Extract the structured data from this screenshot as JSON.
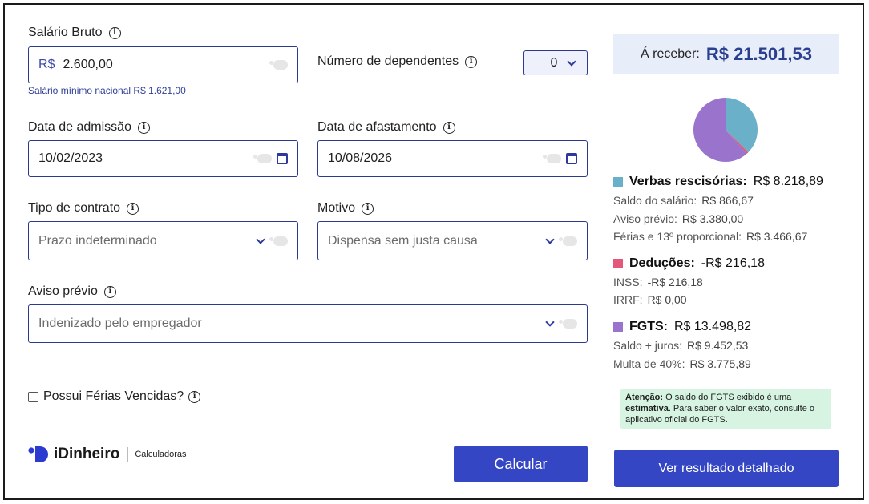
{
  "form": {
    "salario": {
      "label": "Salário Bruto",
      "prefix": "R$",
      "value": "2.600,00",
      "hint": "Salário mínimo nacional R$ 1.621,00"
    },
    "dependentes": {
      "label": "Número de dependentes",
      "value": "0"
    },
    "admissao": {
      "label": "Data de admissão",
      "value": "10/02/2023"
    },
    "afastamento": {
      "label": "Data de afastamento",
      "value": "10/08/2026"
    },
    "contrato": {
      "label": "Tipo de contrato",
      "value": "Prazo indeterminado"
    },
    "motivo": {
      "label": "Motivo",
      "value": "Dispensa sem justa causa"
    },
    "aviso": {
      "label": "Aviso prévio",
      "value": "Indenizado pelo empregador"
    },
    "ferias_vencidas": {
      "label": "Possui Férias Vencidas?",
      "checked": false
    },
    "calcular_label": "Calcular"
  },
  "brand": {
    "name": "iDinheiro",
    "section": "Calculadoras",
    "logo_color": "#2b3acf"
  },
  "result": {
    "receber_label": "Á receber:",
    "receber_value": "R$ 21.501,53",
    "pie": [
      {
        "name": "Verbas rescisórias",
        "value": 8218.89,
        "color": "#6ab0c8"
      },
      {
        "name": "Deduções",
        "value": 216.18,
        "color": "#e4567a"
      },
      {
        "name": "FGTS",
        "value": 13498.82,
        "color": "#9a73cd"
      }
    ],
    "verbas": {
      "title": "Verbas rescisórias:",
      "total": "R$ 8.218,89",
      "color": "#6ab0c8",
      "items": [
        {
          "label": "Saldo do salário:",
          "value": "R$ 866,67"
        },
        {
          "label": "Aviso prévio:",
          "value": "R$ 3.380,00"
        },
        {
          "label": "Férias e 13º proporcional:",
          "value": "R$ 3.466,67"
        }
      ]
    },
    "deducoes": {
      "title": "Deduções:",
      "total": "-R$ 216,18",
      "color": "#e4567a",
      "items": [
        {
          "label": "INSS:",
          "value": "-R$ 216,18"
        },
        {
          "label": "IRRF:",
          "value": "R$ 0,00"
        }
      ]
    },
    "fgts": {
      "title": "FGTS:",
      "total": "R$ 13.498,82",
      "color": "#9a73cd",
      "items": [
        {
          "label": "Saldo + juros:",
          "value": "R$ 9.452,53"
        },
        {
          "label": "Multa de 40%:",
          "value": "R$ 3.775,89"
        }
      ]
    },
    "alert": {
      "strong1": "Atenção:",
      "text1": " O saldo do FGTS exibido é uma ",
      "strong2": "estimativa",
      "text2": ". Para saber o valor exato, consulte o aplicativo oficial do FGTS."
    },
    "detalhado_label": "Ver resultado detalhado"
  }
}
